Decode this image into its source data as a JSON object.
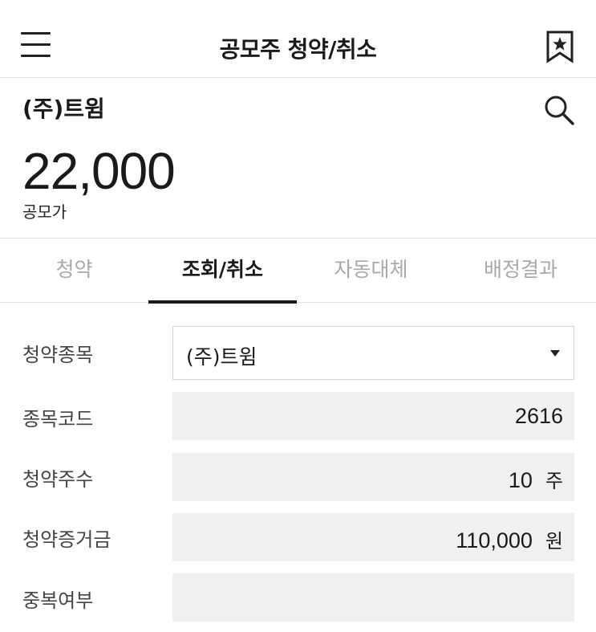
{
  "header": {
    "title": "공모주 청약/취소",
    "menu_icon": "hamburger-icon",
    "bookmark_icon": "bookmark-star-icon"
  },
  "stock": {
    "name": "(주)트윔",
    "price": "22,000",
    "price_label": "공모가",
    "search_icon": "search-icon"
  },
  "tabs": [
    {
      "label": "청약",
      "active": false
    },
    {
      "label": "조회/취소",
      "active": true
    },
    {
      "label": "자동대체",
      "active": false
    },
    {
      "label": "배정결과",
      "active": false
    }
  ],
  "form": {
    "stock_select": {
      "label": "청약종목",
      "value": "(주)트윔",
      "icon": "caret-down-icon"
    },
    "stock_code": {
      "label": "종목코드",
      "value": "2616"
    },
    "quantity": {
      "label": "청약주수",
      "value": "10",
      "unit": "주"
    },
    "deposit": {
      "label": "청약증거금",
      "value": "110,000",
      "unit": "원"
    },
    "duplicate": {
      "label": "중복여부",
      "value": ""
    }
  }
}
